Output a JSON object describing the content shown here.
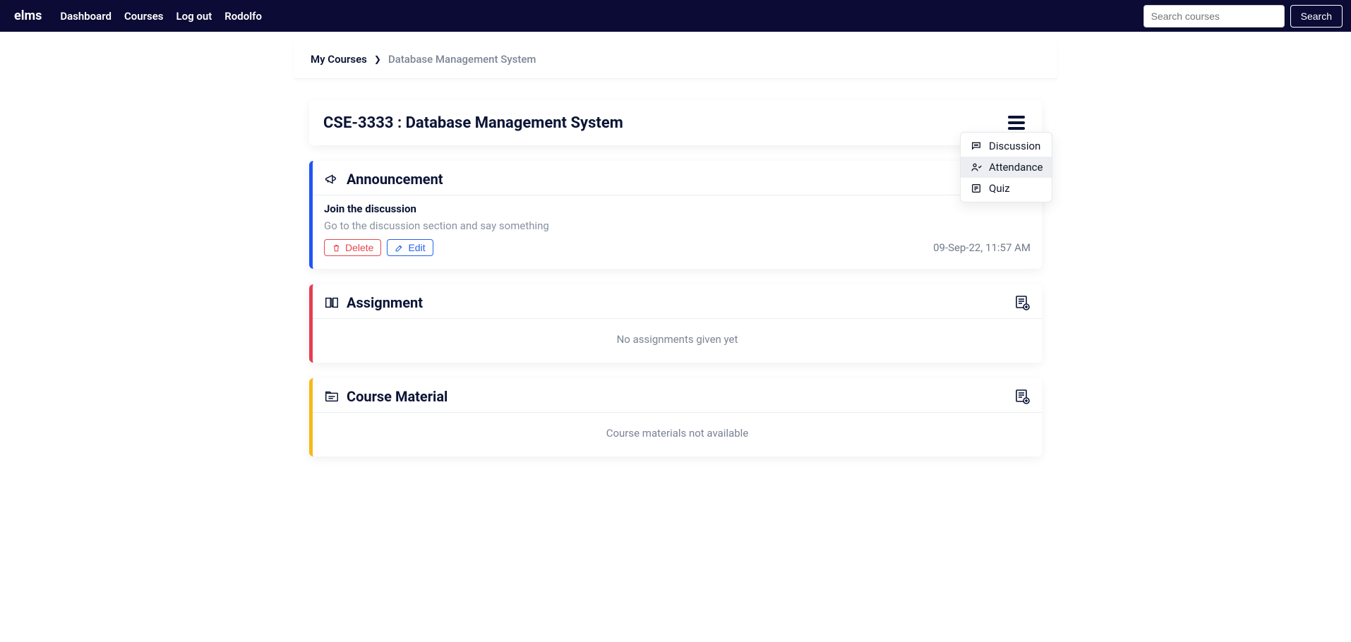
{
  "nav": {
    "brand": "elms",
    "links": [
      "Dashboard",
      "Courses",
      "Log out",
      "Rodolfo"
    ],
    "search_placeholder": "Search courses",
    "search_button": "Search"
  },
  "breadcrumb": {
    "root": "My Courses",
    "current": "Database Management System"
  },
  "course": {
    "title": "CSE-3333 : Database Management System"
  },
  "dropdown": {
    "items": [
      {
        "label": "Discussion"
      },
      {
        "label": "Attendance"
      },
      {
        "label": "Quiz"
      }
    ]
  },
  "announcement": {
    "heading": "Announcement",
    "title": "Join the discussion",
    "description": "Go to the discussion section and say something",
    "delete_label": "Delete",
    "edit_label": "Edit",
    "timestamp": "09-Sep-22, 11:57 AM"
  },
  "assignment": {
    "heading": "Assignment",
    "empty": "No assignments given yet"
  },
  "material": {
    "heading": "Course Material",
    "empty": "Course materials not available"
  }
}
